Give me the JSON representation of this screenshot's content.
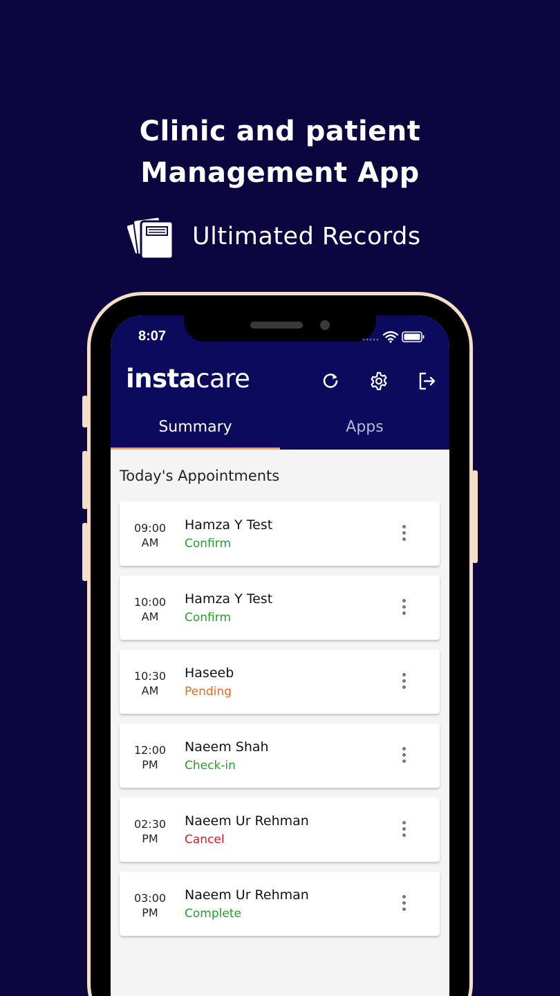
{
  "promo": {
    "title_line1": "Clinic and patient",
    "title_line2": "Management App",
    "subtitle": "Ultimated Records"
  },
  "status_bar": {
    "time": "8:07"
  },
  "app": {
    "logo_bold": "insta",
    "logo_light": "care"
  },
  "header_icons": [
    "refresh-icon",
    "gear-icon",
    "logout-icon"
  ],
  "tabs": [
    {
      "label": "Summary",
      "active": true
    },
    {
      "label": "Apps",
      "active": false
    }
  ],
  "section_title": "Today's Appointments",
  "appointments": [
    {
      "time": "09:00",
      "period": "AM",
      "name": "Hamza Y Test",
      "status": "Confirm",
      "status_color": "#22a02c"
    },
    {
      "time": "10:00",
      "period": "AM",
      "name": "Hamza Y Test",
      "status": "Confirm",
      "status_color": "#22a02c"
    },
    {
      "time": "10:30",
      "period": "AM",
      "name": "Haseeb",
      "status": "Pending",
      "status_color": "#e46b1e"
    },
    {
      "time": "12:00",
      "period": "PM",
      "name": "Naeem Shah",
      "status": "Check-in",
      "status_color": "#22a02c"
    },
    {
      "time": "02:30",
      "period": "PM",
      "name": "Naeem Ur Rehman",
      "status": "Cancel",
      "status_color": "#d81e1e"
    },
    {
      "time": "03:00",
      "period": "PM",
      "name": "Naeem Ur Rehman",
      "status": "Complete",
      "status_color": "#22a02c"
    }
  ],
  "colors": {
    "background": "#0b0640",
    "app_header": "#0b0a5c",
    "tab_indicator": "#f0a15a",
    "phone_frame": "#f6ddc6"
  }
}
